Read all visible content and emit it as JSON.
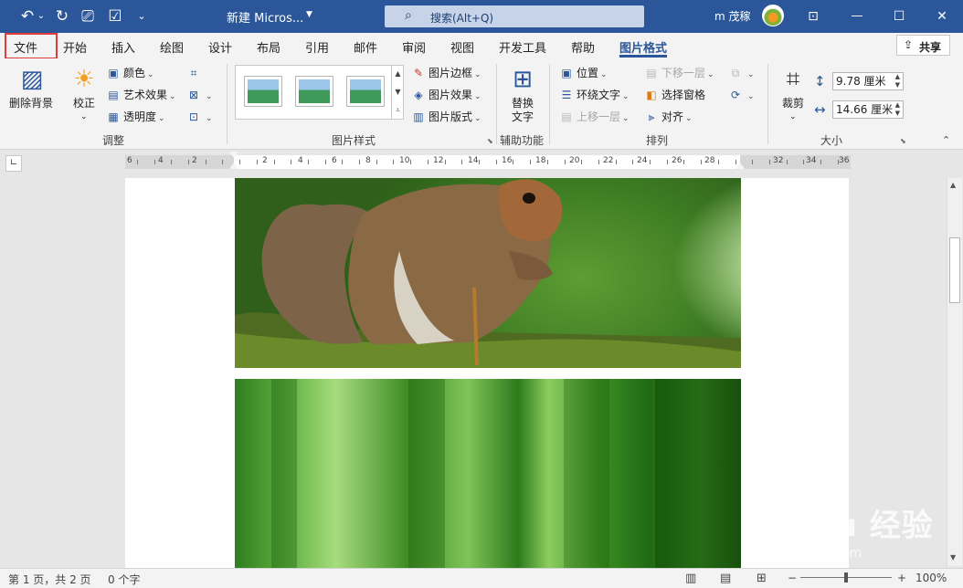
{
  "titlebar": {
    "doc_title": "新建 Micros...",
    "search_text": "搜索(Alt+Q)",
    "user_name": "m 茂稼",
    "undo_icon": "↶",
    "undo_caret": "⌄",
    "redo_icon": "↻",
    "touch_icon": "⎚",
    "check_icon": "☑",
    "customize_icon": "⌄",
    "ribbon_display_icon": "⊡",
    "minimize_icon": "—",
    "maximize_icon": "☐",
    "close_icon": "✕"
  },
  "tabs": [
    "文件",
    "开始",
    "插入",
    "绘图",
    "设计",
    "布局",
    "引用",
    "邮件",
    "审阅",
    "视图",
    "开发工具",
    "帮助",
    "图片格式"
  ],
  "share_label": "共享",
  "ribbon": {
    "remove_bg": "删除背景",
    "corrections": "校正",
    "color": "颜色",
    "artistic": "艺术效果",
    "transparency": "透明度",
    "adjust_group": "调整",
    "picture_border": "图片边框",
    "picture_effects": "图片效果",
    "picture_layout": "图片版式",
    "styles_group": "图片样式",
    "alt_text_line1": "替换",
    "alt_text_line2": "文字",
    "accessibility_group": "辅助功能",
    "position": "位置",
    "wrap_text": "环绕文字",
    "bring_forward": "上移一层",
    "send_backward": "下移一层",
    "selection_pane": "选择窗格",
    "align": "对齐",
    "arrange_group": "排列",
    "crop": "裁剪",
    "height_value": "9.78 厘米",
    "width_value": "14.66 厘米",
    "size_group": "大小"
  },
  "ruler": {
    "numbers": [
      "6",
      "4",
      "2",
      "2",
      "4",
      "6",
      "8",
      "10",
      "12",
      "14",
      "16",
      "18",
      "20",
      "22",
      "24",
      "26",
      "28",
      "32",
      "34",
      "36"
    ],
    "corner": "∟"
  },
  "watermark": {
    "main": "Bai du 经验",
    "sub": "jingyan.baidu.com"
  },
  "status": {
    "page_info": "第 1 页，共 2 页",
    "word_count": "0 个字",
    "zoom_minus": "−",
    "zoom_plus": "+",
    "zoom_level": "100%"
  }
}
